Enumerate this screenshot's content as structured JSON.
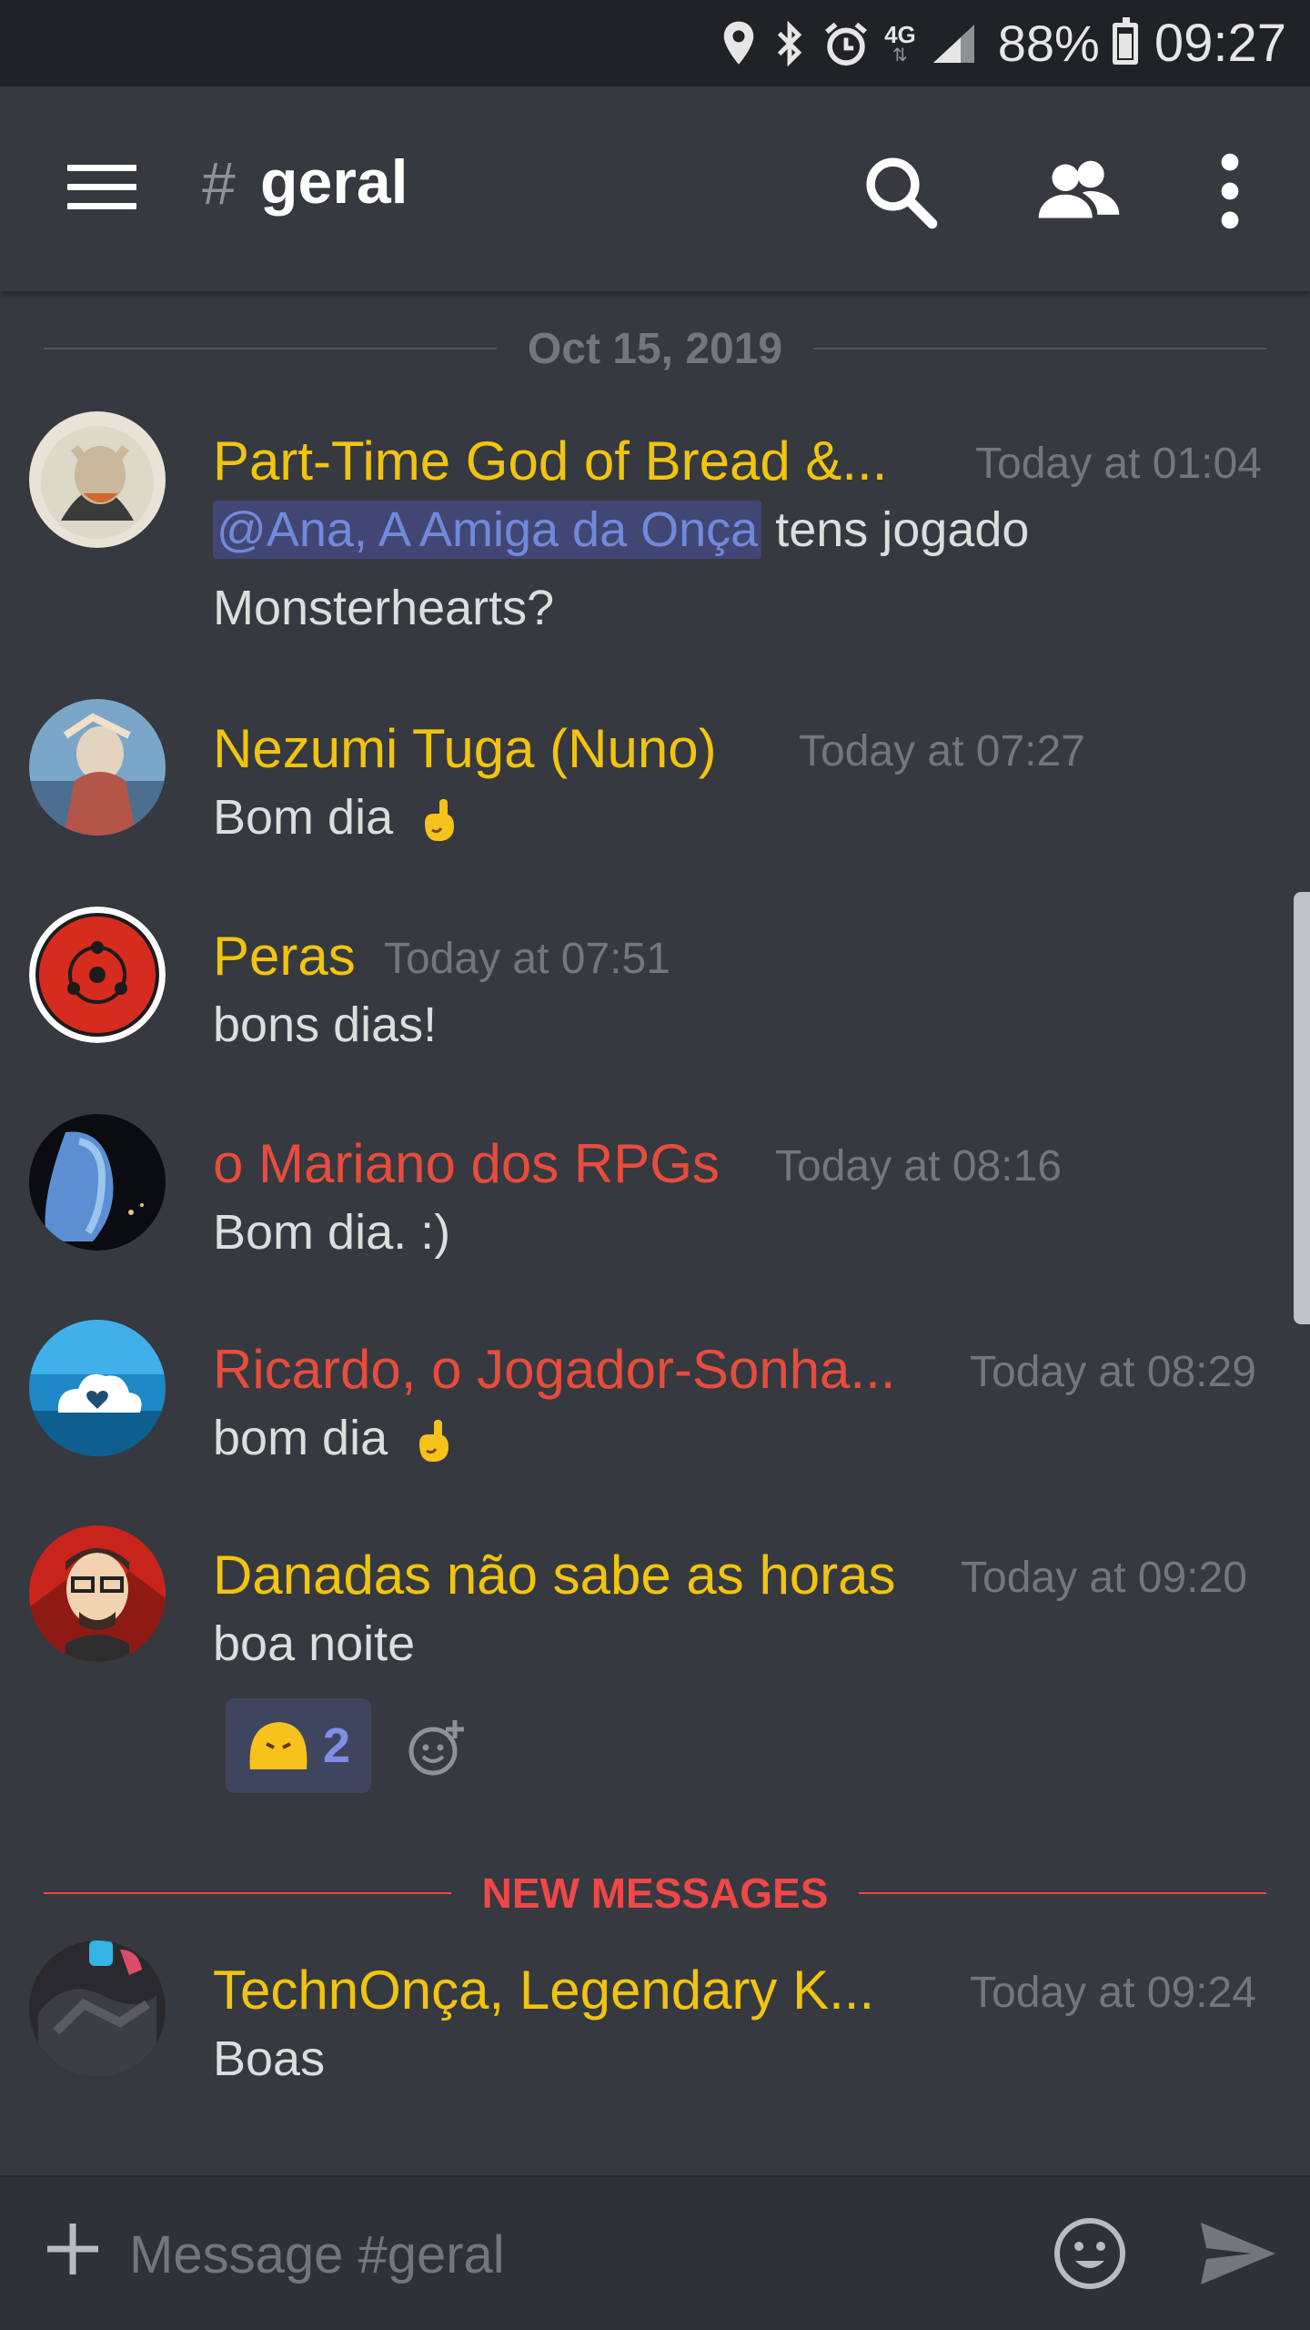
{
  "status_bar": {
    "battery_percent": "88%",
    "time": "09:27",
    "network": "4G",
    "icons": [
      "location-icon",
      "bluetooth-icon",
      "alarm-icon",
      "network-4g-icon",
      "signal-icon",
      "battery-icon"
    ]
  },
  "header": {
    "hash": "#",
    "channel": "geral",
    "icons": [
      "hamburger-menu-icon",
      "search-icon",
      "members-icon",
      "more-vertical-icon"
    ]
  },
  "date_divider": "Oct 15, 2019",
  "messages": [
    {
      "username": "Part-Time God of Bread &...",
      "name_color": "#f1c40f",
      "timestamp": "Today at 01:04",
      "mention": "@Ana, A Amiga da Onça",
      "line1": " tens jogado",
      "line2": "Monsterhearts?"
    },
    {
      "username": "Nezumi Tuga (Nuno)",
      "name_color": "#f1c40f",
      "timestamp": "Today at 07:27",
      "text": "Bom dia"
    },
    {
      "username": "Peras",
      "name_color": "#f1c40f",
      "timestamp": "Today at 07:51",
      "text": "bons dias!"
    },
    {
      "username": "o Mariano dos RPGs",
      "name_color": "#e74c3c",
      "timestamp": "Today at 08:16",
      "text": "Bom dia. :)"
    },
    {
      "username": "Ricardo, o Jogador-Sonha...",
      "name_color": "#e74c3c",
      "timestamp": "Today at 08:29",
      "text": "bom dia"
    },
    {
      "username": "Danadas não sabe as horas",
      "name_color": "#f1c40f",
      "timestamp": "Today at 09:20",
      "text": "boa noite",
      "reaction_count": "2"
    },
    {
      "username": "TechnOnça, Legendary K...",
      "name_color": "#f1c40f",
      "timestamp": "Today at 09:24",
      "text": "Boas"
    }
  ],
  "new_messages_label": "NEW MESSAGES",
  "input": {
    "placeholder": "Message #geral"
  },
  "colors": {
    "background": "#36393f",
    "mention_bg": "#414675",
    "mention_text": "#7289da",
    "new_messages": "#f04747"
  }
}
